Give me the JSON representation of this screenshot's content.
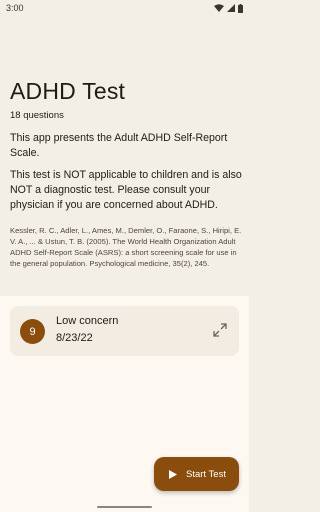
{
  "status_bar": {
    "time": "3:00"
  },
  "header": {
    "title": "ADHD Test",
    "question_count": "18 questions",
    "intro": "This app presents the Adult ADHD Self-Report Scale.",
    "disclaimer": "This test is NOT applicable to children and is also NOT a diagnostic test. Please consult your physician if you are concerned about ADHD.",
    "citation": "Kessler, R. C., Adler, L., Ames, M., Demler, O., Faraone, S., Hiripi, E. V. A., ... & Ustun, T. B. (2005). The World Health Organization Adult ADHD Self-Report Scale (ASRS): a short screening scale for use in the general population. Psychological medicine, 35(2), 245."
  },
  "results": [
    {
      "score": "9",
      "label": "Low concern",
      "date": "8/23/22",
      "icon": "expand-icon"
    }
  ],
  "fab": {
    "label": "Start Test",
    "icon": "play-icon"
  },
  "colors": {
    "accent": "#8b4d0d",
    "header_bg": "#f4efe6",
    "content_bg": "#fdf8f2",
    "card_bg": "#f3ece2"
  }
}
